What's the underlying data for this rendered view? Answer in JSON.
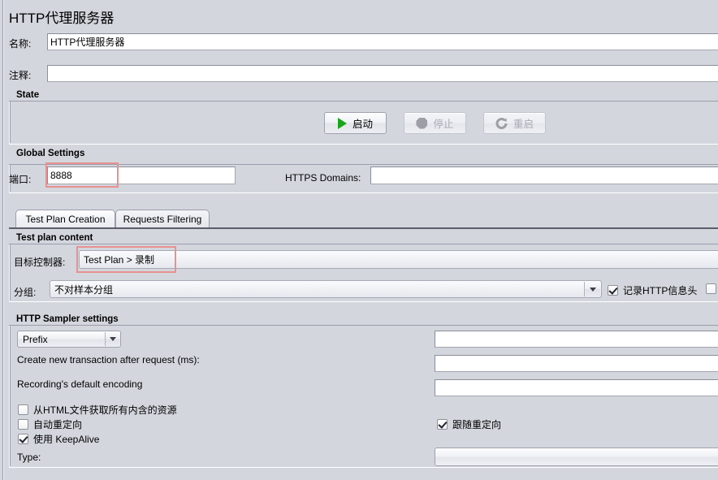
{
  "window": {
    "title": "HTTP代理服务器"
  },
  "form": {
    "name_label": "名称:",
    "name_value": "HTTP代理服务器",
    "comment_label": "注释:",
    "comment_value": ""
  },
  "state_panel": {
    "title": "State",
    "buttons": [
      {
        "label": "启动",
        "icon": "play-icon",
        "enabled": true
      },
      {
        "label": "停止",
        "icon": "stop-icon",
        "enabled": false
      },
      {
        "label": "重启",
        "icon": "restart-icon",
        "enabled": false
      }
    ]
  },
  "global_settings": {
    "title": "Global Settings",
    "port_label": "端口:",
    "port_value": "8888",
    "https_domains_label": "HTTPS Domains:",
    "https_domains_value": ""
  },
  "tabs": [
    {
      "label": "Test Plan Creation",
      "active": true
    },
    {
      "label": "Requests Filtering",
      "active": false
    }
  ],
  "test_plan_content": {
    "title": "Test plan content",
    "target_controller_label": "目标控制器:",
    "target_controller_value": "Test Plan > 录制",
    "grouping_label": "分组:",
    "grouping_value": "不对样本分组",
    "capture_headers_label": "记录HTTP信息头",
    "capture_headers_checked": true,
    "extra_checkbox_checked": false
  },
  "http_sampler_settings": {
    "title": "HTTP Sampler settings",
    "prefix_mode_value": "Prefix",
    "prefix_value": "",
    "new_transaction_label": "Create new transaction after request (ms):",
    "new_transaction_value": "",
    "default_encoding_label": "Recording's default encoding",
    "default_encoding_value": "",
    "retrieve_resources_label": "从HTML文件获取所有内含的资源",
    "retrieve_resources_checked": false,
    "auto_redirect_label": "自动重定向",
    "auto_redirect_checked": false,
    "keepalive_label": "使用 KeepAlive",
    "keepalive_checked": true,
    "follow_redirects_label": "跟随重定向",
    "follow_redirects_checked": true,
    "type_label": "Type:",
    "type_value": ""
  },
  "annotations": {
    "accent_color": "#e8918f",
    "highlighted": [
      "port-field",
      "target-controller-combo"
    ]
  }
}
